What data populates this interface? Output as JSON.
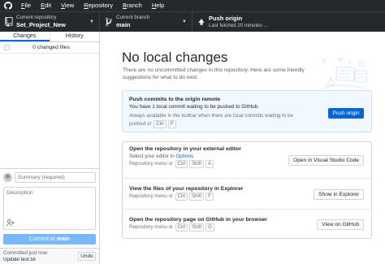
{
  "menu": [
    "File",
    "Edit",
    "View",
    "Repository",
    "Branch",
    "Help"
  ],
  "menu_underline": [
    "F",
    "E",
    "V",
    "R",
    "B",
    "H"
  ],
  "toolbar": {
    "repo_label": "Current repository",
    "repo_name": "Set_Project_New",
    "branch_label": "Current branch",
    "branch_name": "main",
    "push_title": "Push origin",
    "push_sub": "Last fetched 20 minutes ..."
  },
  "sidebar": {
    "tab_changes": "Changes",
    "tab_history": "History",
    "changed_files": "0 changed files",
    "summary_placeholder": "Summary (required)",
    "description_placeholder": "Description",
    "commit_prefix": "Commit to ",
    "commit_branch": "main",
    "undo_line1": "Committed just now",
    "undo_line2": "Update test.txt",
    "undo_button": "Undo"
  },
  "main": {
    "heading": "No local changes",
    "subtext": "There are no uncommitted changes in this repository. Here are some friendly suggestions for what to do next.",
    "push_card": {
      "title": "Push commits to the origin remote",
      "desc": "You have 1 local commit waiting to be pushed to GitHub.",
      "hint_prefix": "Always available in the toolbar when there are local commits waiting to be pushed or",
      "hint_keys": [
        "Ctrl",
        "P"
      ],
      "button": "Push origin"
    },
    "actions": [
      {
        "title": "Open the repository in your external editor",
        "desc_prefix": "Select your editor in ",
        "desc_link": "Options",
        "hint_prefix": "Repository menu or",
        "hint_keys": [
          "Ctrl",
          "Shift",
          "A"
        ],
        "button": "Open in Visual Studio Code"
      },
      {
        "title": "View the files of your repository in Explorer",
        "hint_prefix": "Repository menu or",
        "hint_keys": [
          "Ctrl",
          "Shift",
          "F"
        ],
        "button": "Show in Explorer"
      },
      {
        "title": "Open the repository page on GitHub in your browser",
        "hint_prefix": "Repository menu or",
        "hint_keys": [
          "Ctrl",
          "Shift",
          "G"
        ],
        "button": "View on GitHub"
      }
    ]
  },
  "icons": {
    "logo": "github-logo-icon",
    "repo": "repo-icon",
    "branch": "git-branch-icon",
    "push": "arrow-up-icon",
    "caret": "chevron-down-icon",
    "coauthor": "person-add-icon"
  },
  "colors": {
    "titlebar": "#24292e",
    "accent": "#0366d6",
    "commit_button_disabled": "#79b8ff",
    "push_card_bg": "#f1f8ff"
  }
}
